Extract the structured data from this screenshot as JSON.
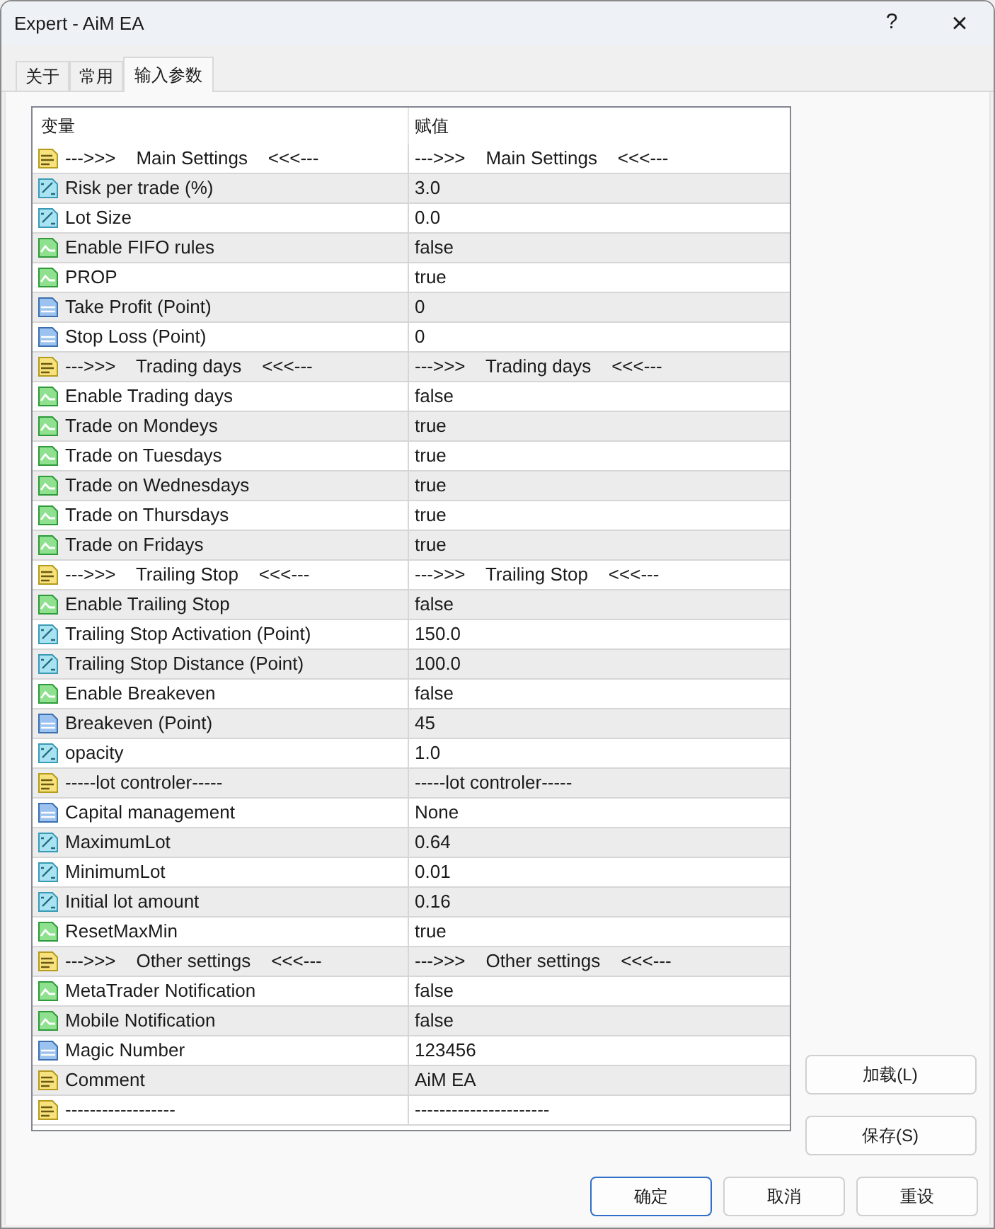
{
  "window": {
    "title": "Expert - AiM EA",
    "help": "?",
    "close": "×"
  },
  "tabs": [
    {
      "label": "关于",
      "selected": false
    },
    {
      "label": "常用",
      "selected": false
    },
    {
      "label": "输入参数",
      "selected": true
    }
  ],
  "table": {
    "columns": [
      "变量",
      "赋值"
    ],
    "rows": [
      {
        "kind": "string",
        "variable": "--->>>    Main Settings    <<<---",
        "value": "--->>>    Main Settings    <<<---"
      },
      {
        "kind": "double",
        "variable": "Risk per trade (%)",
        "value": "3.0"
      },
      {
        "kind": "double",
        "variable": "Lot Size",
        "value": "0.0"
      },
      {
        "kind": "bool",
        "variable": "Enable FIFO rules",
        "value": "false"
      },
      {
        "kind": "bool",
        "variable": "PROP",
        "value": "true"
      },
      {
        "kind": "int",
        "variable": "Take Profit (Point)",
        "value": "0"
      },
      {
        "kind": "int",
        "variable": "Stop Loss (Point)",
        "value": "0"
      },
      {
        "kind": "string",
        "variable": "--->>>    Trading days    <<<---",
        "value": "--->>>    Trading days    <<<---"
      },
      {
        "kind": "bool",
        "variable": "Enable Trading days",
        "value": "false"
      },
      {
        "kind": "bool",
        "variable": "Trade on Mondeys",
        "value": "true"
      },
      {
        "kind": "bool",
        "variable": "Trade on Tuesdays",
        "value": "true"
      },
      {
        "kind": "bool",
        "variable": "Trade on Wednesdays",
        "value": "true"
      },
      {
        "kind": "bool",
        "variable": "Trade on Thursdays",
        "value": "true"
      },
      {
        "kind": "bool",
        "variable": "Trade on Fridays",
        "value": "true"
      },
      {
        "kind": "string",
        "variable": "--->>>    Trailing Stop    <<<---",
        "value": "--->>>    Trailing Stop    <<<---"
      },
      {
        "kind": "bool",
        "variable": "Enable Trailing Stop",
        "value": "false"
      },
      {
        "kind": "double",
        "variable": "Trailing Stop Activation (Point)",
        "value": "150.0"
      },
      {
        "kind": "double",
        "variable": "Trailing Stop Distance (Point)",
        "value": "100.0"
      },
      {
        "kind": "bool",
        "variable": "Enable Breakeven",
        "value": "false"
      },
      {
        "kind": "int",
        "variable": "Breakeven (Point)",
        "value": "45"
      },
      {
        "kind": "double",
        "variable": "opacity",
        "value": "1.0"
      },
      {
        "kind": "string",
        "variable": "-----lot controler-----",
        "value": "-----lot controler-----"
      },
      {
        "kind": "int",
        "variable": "Capital management",
        "value": "None"
      },
      {
        "kind": "double",
        "variable": "MaximumLot",
        "value": "0.64"
      },
      {
        "kind": "double",
        "variable": "MinimumLot",
        "value": "0.01"
      },
      {
        "kind": "double",
        "variable": "Initial lot amount",
        "value": "0.16"
      },
      {
        "kind": "bool",
        "variable": "ResetMaxMin",
        "value": "true"
      },
      {
        "kind": "string",
        "variable": "--->>>    Other settings    <<<---",
        "value": "--->>>    Other settings    <<<---"
      },
      {
        "kind": "bool",
        "variable": "MetaTrader Notification",
        "value": "false"
      },
      {
        "kind": "bool",
        "variable": "Mobile Notification",
        "value": "false"
      },
      {
        "kind": "int",
        "variable": "Magic Number",
        "value": "123456"
      },
      {
        "kind": "string",
        "variable": "Comment",
        "value": "AiM EA"
      },
      {
        "kind": "string",
        "variable": "------------------",
        "value": "----------------------"
      }
    ]
  },
  "side_buttons": [
    "加载(L)",
    "保存(S)"
  ],
  "buttons": [
    {
      "label": "确定",
      "default": true
    },
    {
      "label": "取消",
      "default": false
    },
    {
      "label": "重设",
      "default": false
    }
  ]
}
